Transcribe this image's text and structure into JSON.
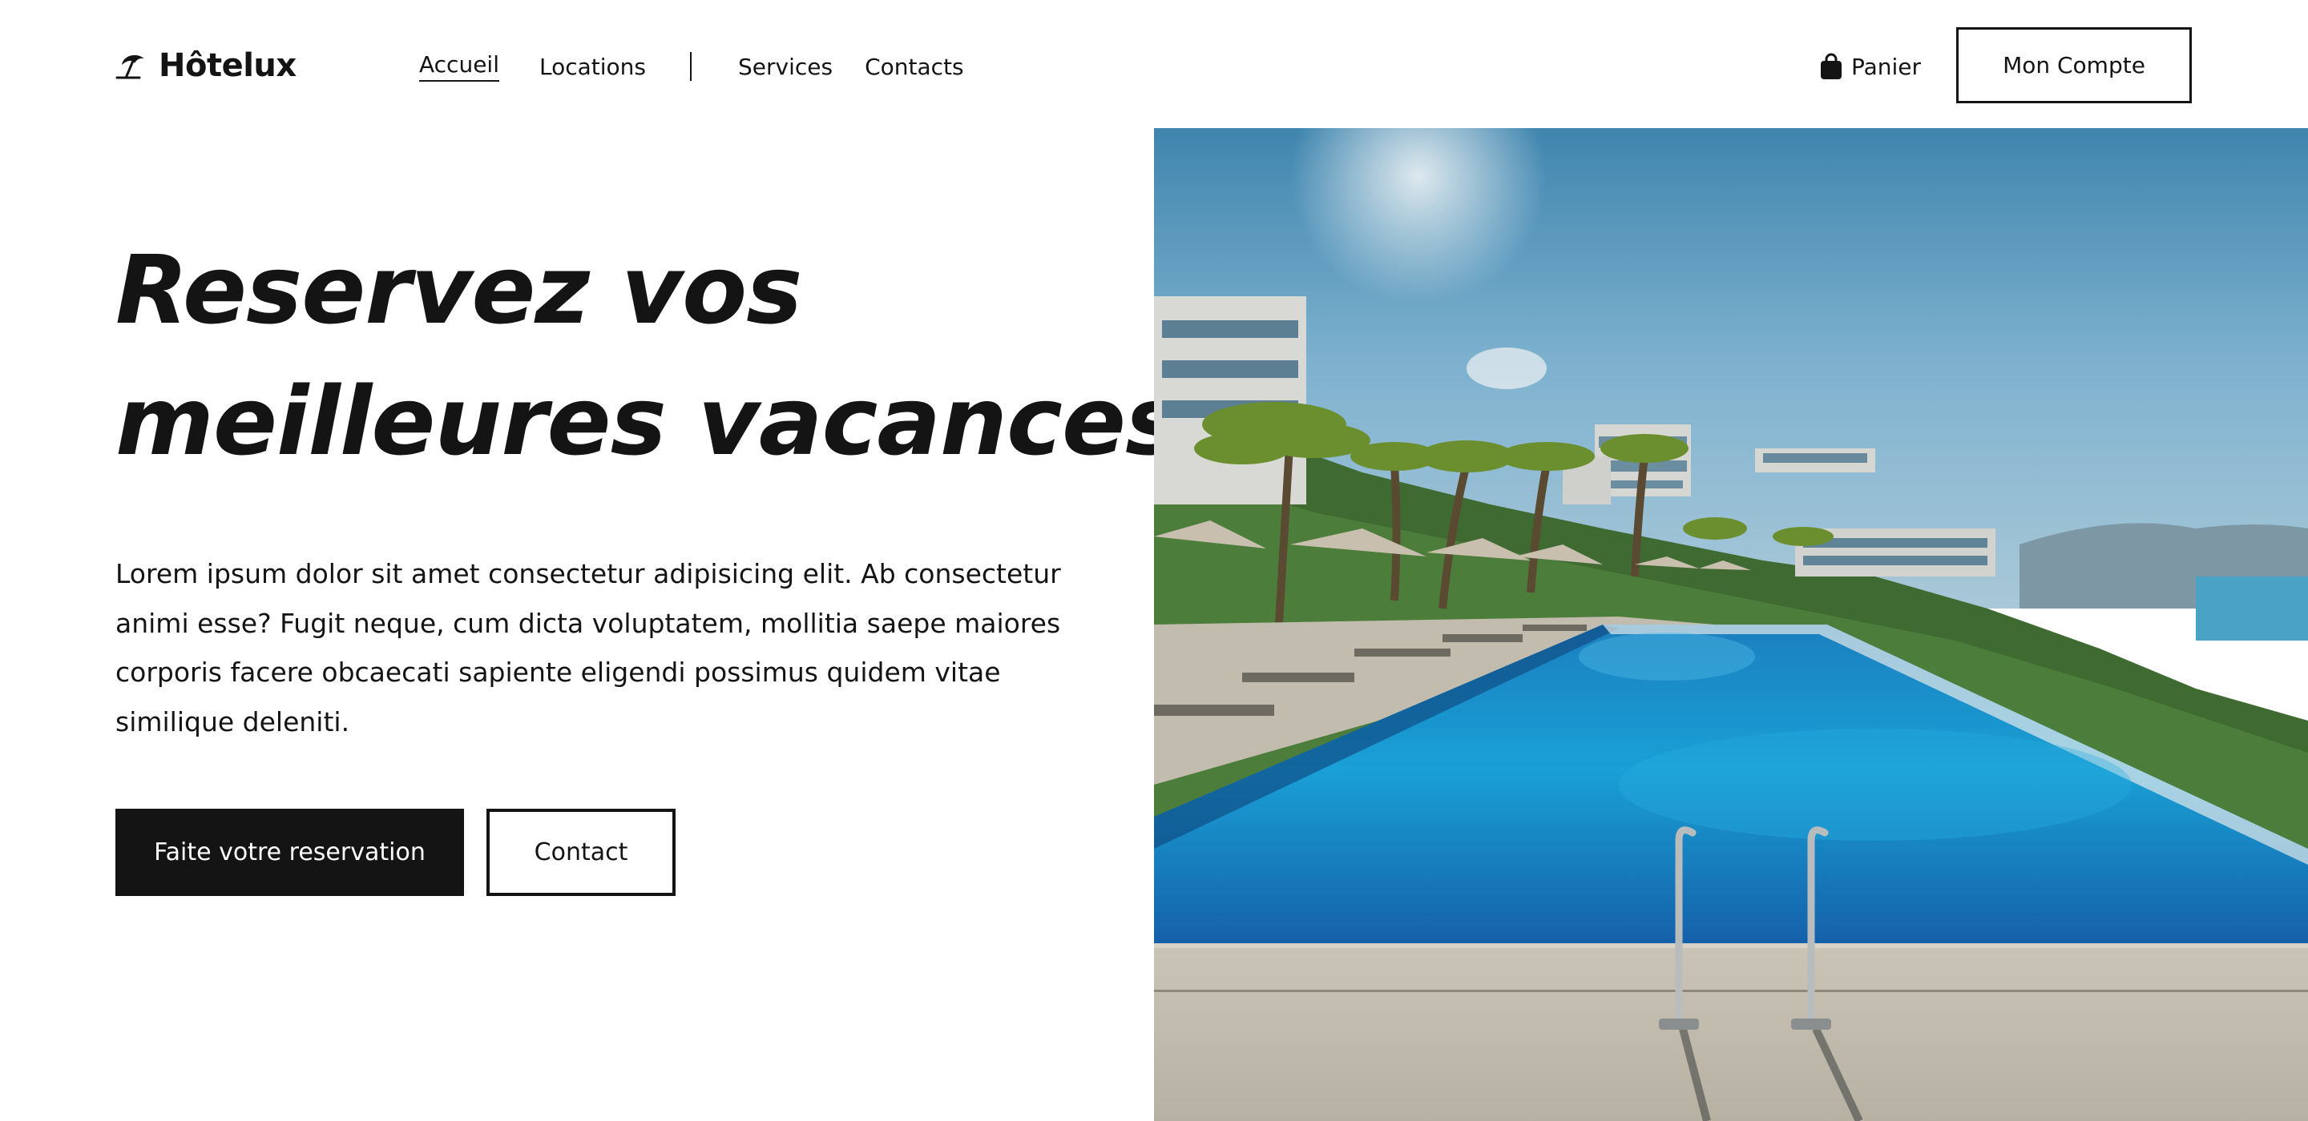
{
  "header": {
    "logo_text": "Hôtelux",
    "logo_icon": "beach-umbrella-icon",
    "nav": [
      {
        "label": "Accueil",
        "active": true
      },
      {
        "label": "Locations",
        "active": false
      },
      {
        "label": "Services",
        "active": false
      },
      {
        "label": "Contacts",
        "active": false
      }
    ],
    "cart_label": "Panier",
    "cart_icon": "shopping-bag-icon",
    "account_label": "Mon Compte"
  },
  "hero": {
    "title_line1": "Reservez vos",
    "title_line2": "meilleures vacances",
    "description": "Lorem ipsum dolor sit amet consectetur adipisicing elit. Ab consectetur animi esse? Fugit neque, cum dicta voluptatem, mollitia saepe maiores corporis facere obcaecati sapiente eligendi possimus quidem vitae similique deleniti.",
    "primary_button": "Faite votre reservation",
    "secondary_button": "Contact"
  },
  "colors": {
    "text": "#141414",
    "background": "#ffffff",
    "button_dark": "#141414",
    "pool_blue": "#1a9fd4"
  }
}
